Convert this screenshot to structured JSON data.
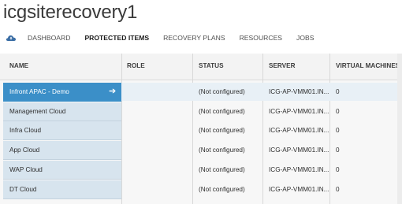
{
  "app": {
    "title": "icgsiterecovery1"
  },
  "nav": {
    "tabs": [
      {
        "label": "DASHBOARD",
        "active": false
      },
      {
        "label": "PROTECTED ITEMS",
        "active": true
      },
      {
        "label": "RECOVERY PLANS",
        "active": false
      },
      {
        "label": "RESOURCES",
        "active": false
      },
      {
        "label": "JOBS",
        "active": false
      }
    ],
    "icon": "cloud-icon"
  },
  "table": {
    "columns": [
      "NAME",
      "ROLE",
      "STATUS",
      "SERVER",
      "VIRTUAL MACHINES"
    ],
    "rows": [
      {
        "name": "Infront APAC - Demo",
        "role": "",
        "status": "(Not configured)",
        "server": "ICG-AP-VMM01.IN...",
        "vms": "0",
        "selected": true
      },
      {
        "name": "Management Cloud",
        "role": "",
        "status": "(Not configured)",
        "server": "ICG-AP-VMM01.IN...",
        "vms": "0",
        "selected": false
      },
      {
        "name": "Infra Cloud",
        "role": "",
        "status": "(Not configured)",
        "server": "ICG-AP-VMM01.IN...",
        "vms": "0",
        "selected": false
      },
      {
        "name": "App Cloud",
        "role": "",
        "status": "(Not configured)",
        "server": "ICG-AP-VMM01.IN...",
        "vms": "0",
        "selected": false
      },
      {
        "name": "WAP Cloud",
        "role": "",
        "status": "(Not configured)",
        "server": "ICG-AP-VMM01.IN...",
        "vms": "0",
        "selected": false
      },
      {
        "name": "DT Cloud",
        "role": "",
        "status": "(Not configured)",
        "server": "ICG-AP-VMM01.IN...",
        "vms": "0",
        "selected": false
      }
    ]
  },
  "colors": {
    "selected_row": "#3b8fc8",
    "name_cell": "#d7e4ee"
  }
}
